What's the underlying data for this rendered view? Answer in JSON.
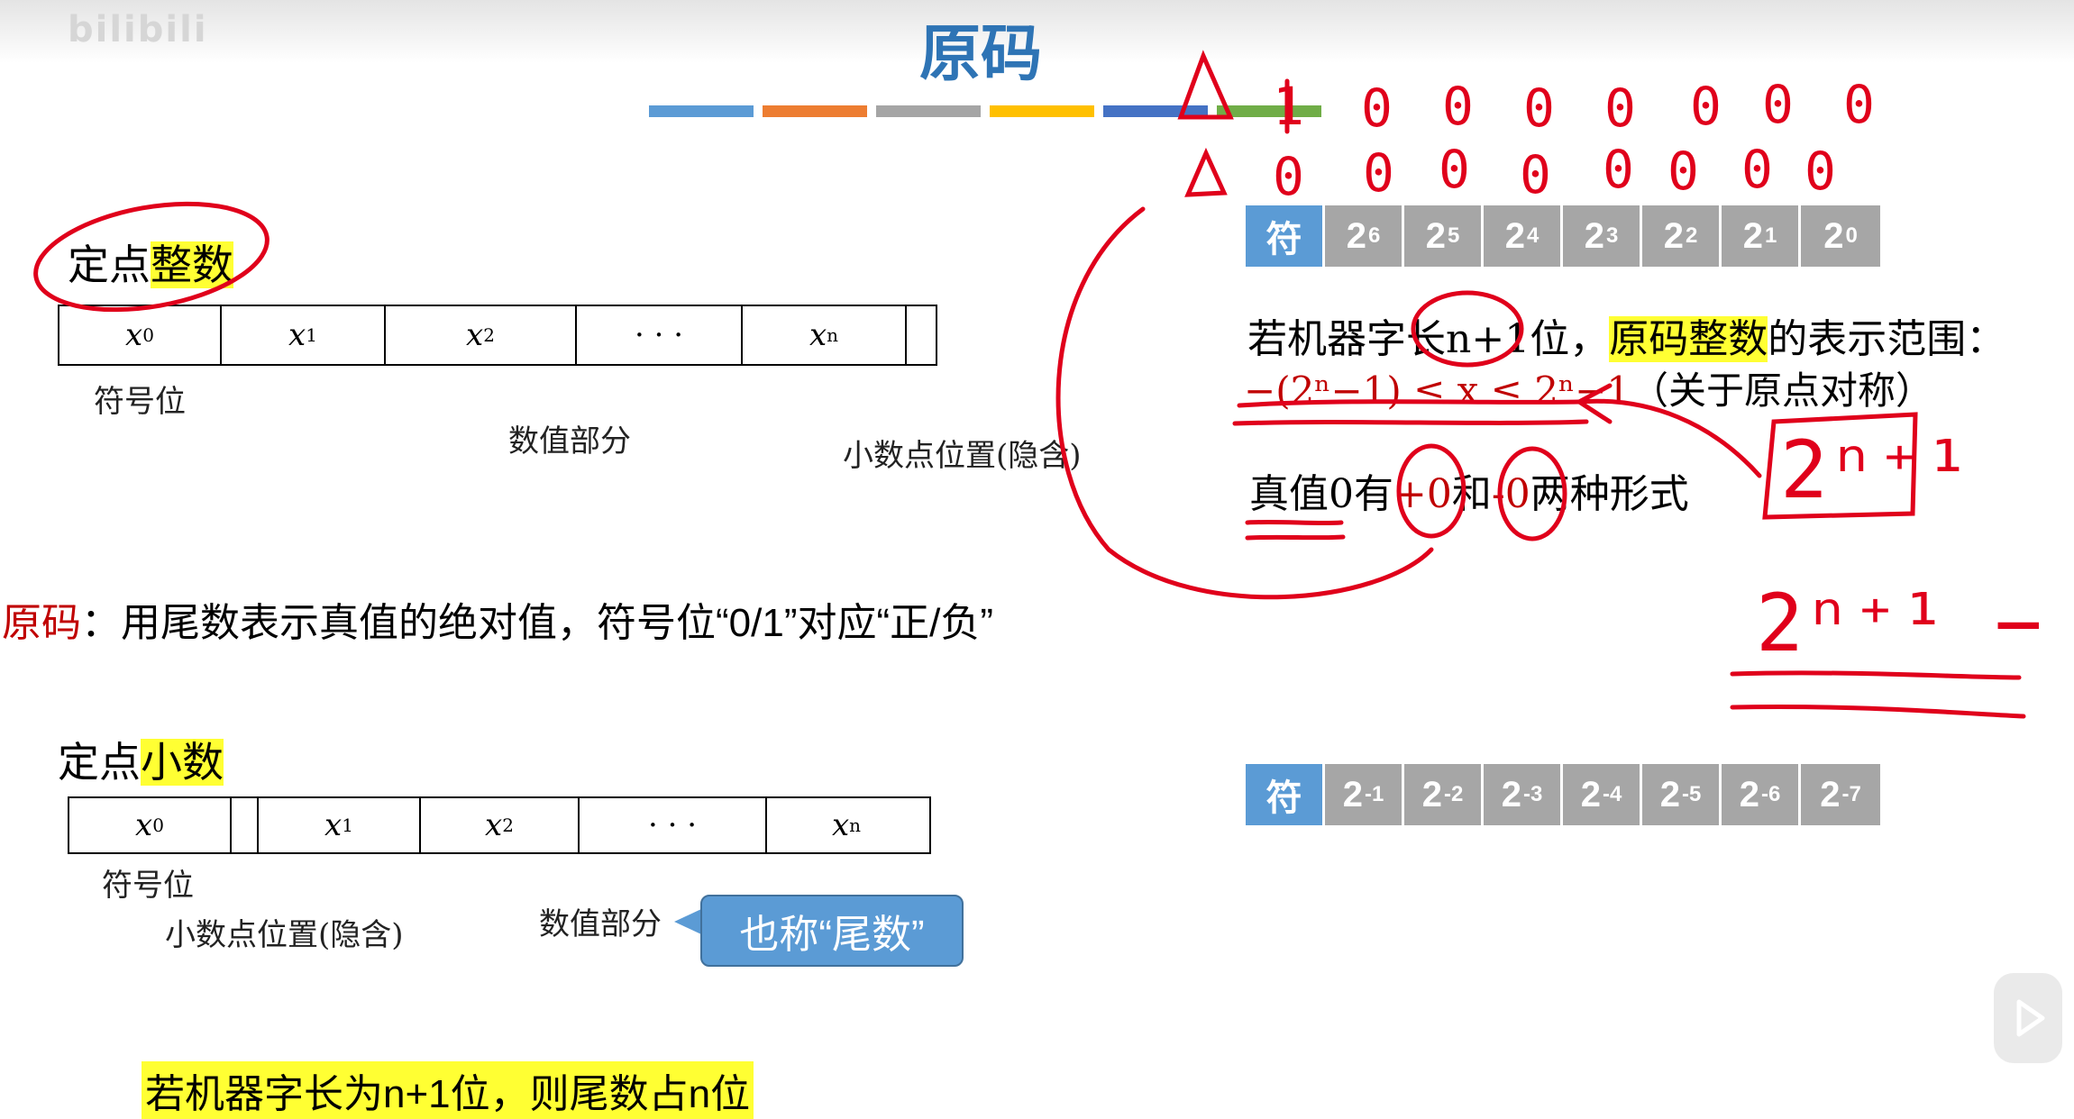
{
  "watermark": "bilibili",
  "title": "原码",
  "color_bar": [
    "#5b9bd5",
    "#ed7d31",
    "#a5a5a5",
    "#ffc000",
    "#4472c4",
    "#70ad47"
  ],
  "integer": {
    "heading_plain": "定点",
    "heading_hl": "整数",
    "cells": [
      {
        "sym": "x",
        "sub": "0"
      },
      {
        "sym": "x",
        "sub": "1"
      },
      {
        "sym": "x",
        "sub": "2"
      },
      {
        "sym": "· · ·",
        "sub": ""
      },
      {
        "sym": "x",
        "sub": "n"
      }
    ],
    "sign_label": "符号位",
    "value_label": "数值部分",
    "point_label": "小数点位置(隐含)"
  },
  "definition": {
    "term": "原码",
    "text": "：用尾数表示真值的绝对值，符号位“0/1”对应“正/负”"
  },
  "fraction": {
    "heading_plain": "定点",
    "heading_hl": "小数",
    "cells": [
      {
        "sym": "x",
        "sub": "0"
      },
      {
        "sym": "x",
        "sub": "1"
      },
      {
        "sym": "x",
        "sub": "2"
      },
      {
        "sym": "· · ·",
        "sub": ""
      },
      {
        "sym": "x",
        "sub": "n"
      }
    ],
    "sign_label": "符号位",
    "point_label": "小数点位置(隐含)",
    "value_label": "数值部分",
    "callout": "也称“尾数”"
  },
  "bottom_note": "若机器字长为n+1位，则尾数占n位",
  "int_bits": {
    "sign": "符",
    "powers": [
      "6",
      "5",
      "4",
      "3",
      "2",
      "1",
      "0"
    ]
  },
  "range": {
    "line1_a": "若机器字长n+1位，",
    "line1_hl": "原码整数",
    "line1_b": "的表示范围：",
    "formula": "−(2ⁿ−1) ≤ x ≤ 2ⁿ−1",
    "note": "（关于原点对称）",
    "zero_text_a": "真值0有",
    "zero_plus": "+0",
    "zero_and": "和",
    "zero_minus": "-0",
    "zero_text_b": "两种形式"
  },
  "frac_bits": {
    "sign": "符",
    "powers": [
      "-1",
      "-2",
      "-3",
      "-4",
      "-5",
      "-6",
      "-7"
    ]
  },
  "handwriting": {
    "row1": [
      "1",
      "0",
      "0",
      "0",
      "0",
      "0",
      "0",
      "0"
    ],
    "row2": [
      "0",
      "0",
      "0",
      "0",
      "0",
      "0",
      "0",
      "0"
    ],
    "expr1": "2ⁿ⁺¹",
    "expr2": "2ⁿ⁺¹ − 1"
  }
}
